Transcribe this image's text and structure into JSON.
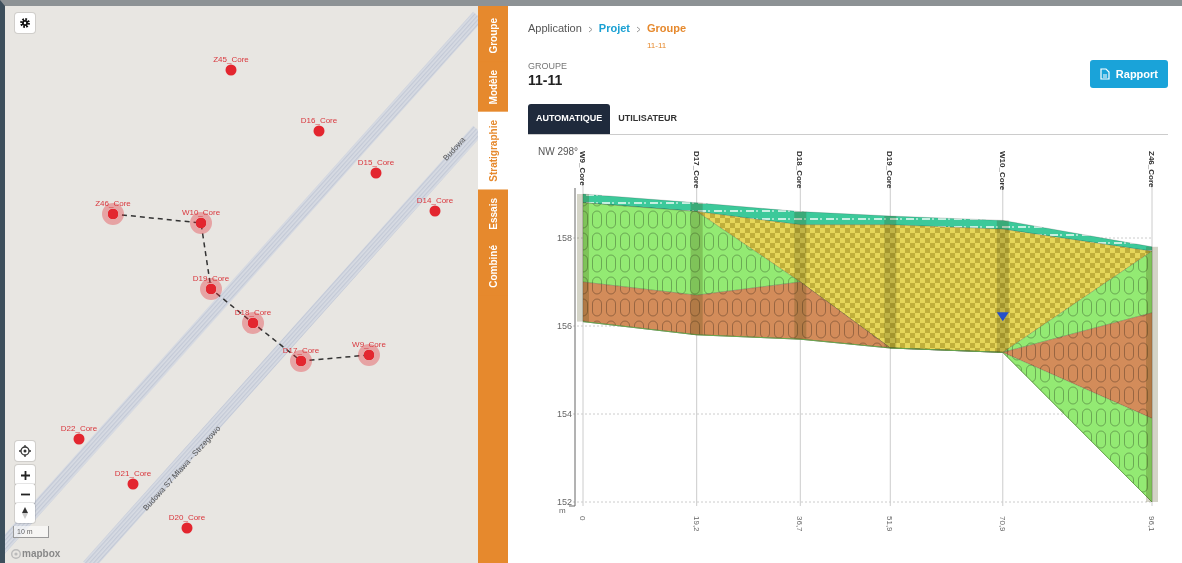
{
  "map": {
    "points": [
      {
        "label": "Z45_Core",
        "selected": false
      },
      {
        "label": "D16_Core",
        "selected": false
      },
      {
        "label": "D15_Core",
        "selected": false
      },
      {
        "label": "D14_Core",
        "selected": false
      },
      {
        "label": "Z46_Core",
        "selected": true
      },
      {
        "label": "W10_Core",
        "selected": true
      },
      {
        "label": "D19_Core",
        "selected": true
      },
      {
        "label": "D18_Core",
        "selected": true
      },
      {
        "label": "D17_Core",
        "selected": true
      },
      {
        "label": "W9_Core",
        "selected": true
      },
      {
        "label": "D22_Core",
        "selected": false
      },
      {
        "label": "D21_Core",
        "selected": false
      },
      {
        "label": "D20_Core",
        "selected": false
      }
    ],
    "road_labels": [
      "Budowa S7 Mława - Strzegowo",
      "Budowa"
    ],
    "scale": "10 m",
    "attribution": "mapbox"
  },
  "side_tabs": [
    {
      "label": "Groupe",
      "selected": false
    },
    {
      "label": "Modèle",
      "selected": false
    },
    {
      "label": "Stratigraphie",
      "selected": true
    },
    {
      "label": "Essais",
      "selected": false
    },
    {
      "label": "Combiné",
      "selected": false
    }
  ],
  "breadcrumb": [
    {
      "label": "Application",
      "kind": "root"
    },
    {
      "label": "Projet",
      "kind": "link"
    },
    {
      "label": "Groupe",
      "kind": "current",
      "sub": "11-11"
    }
  ],
  "header": {
    "caption": "GROUPE",
    "title": "11-11",
    "button": "Rapport"
  },
  "tabs": [
    {
      "label": "AUTOMATIQUE",
      "selected": true
    },
    {
      "label": "UTILISATEUR",
      "selected": false
    }
  ],
  "section": {
    "title": "NW 298°",
    "unit": "m",
    "boreholes": [
      "W9_Core",
      "D17_Core",
      "D18_Core",
      "D19_Core",
      "W10_Core",
      "Z46_Core"
    ],
    "distance_labels": [
      "0",
      "19,2",
      "36,7",
      "51,9",
      "70,9",
      "96,1"
    ],
    "elevation_labels": [
      "158",
      "156",
      "154",
      "152"
    ]
  }
}
